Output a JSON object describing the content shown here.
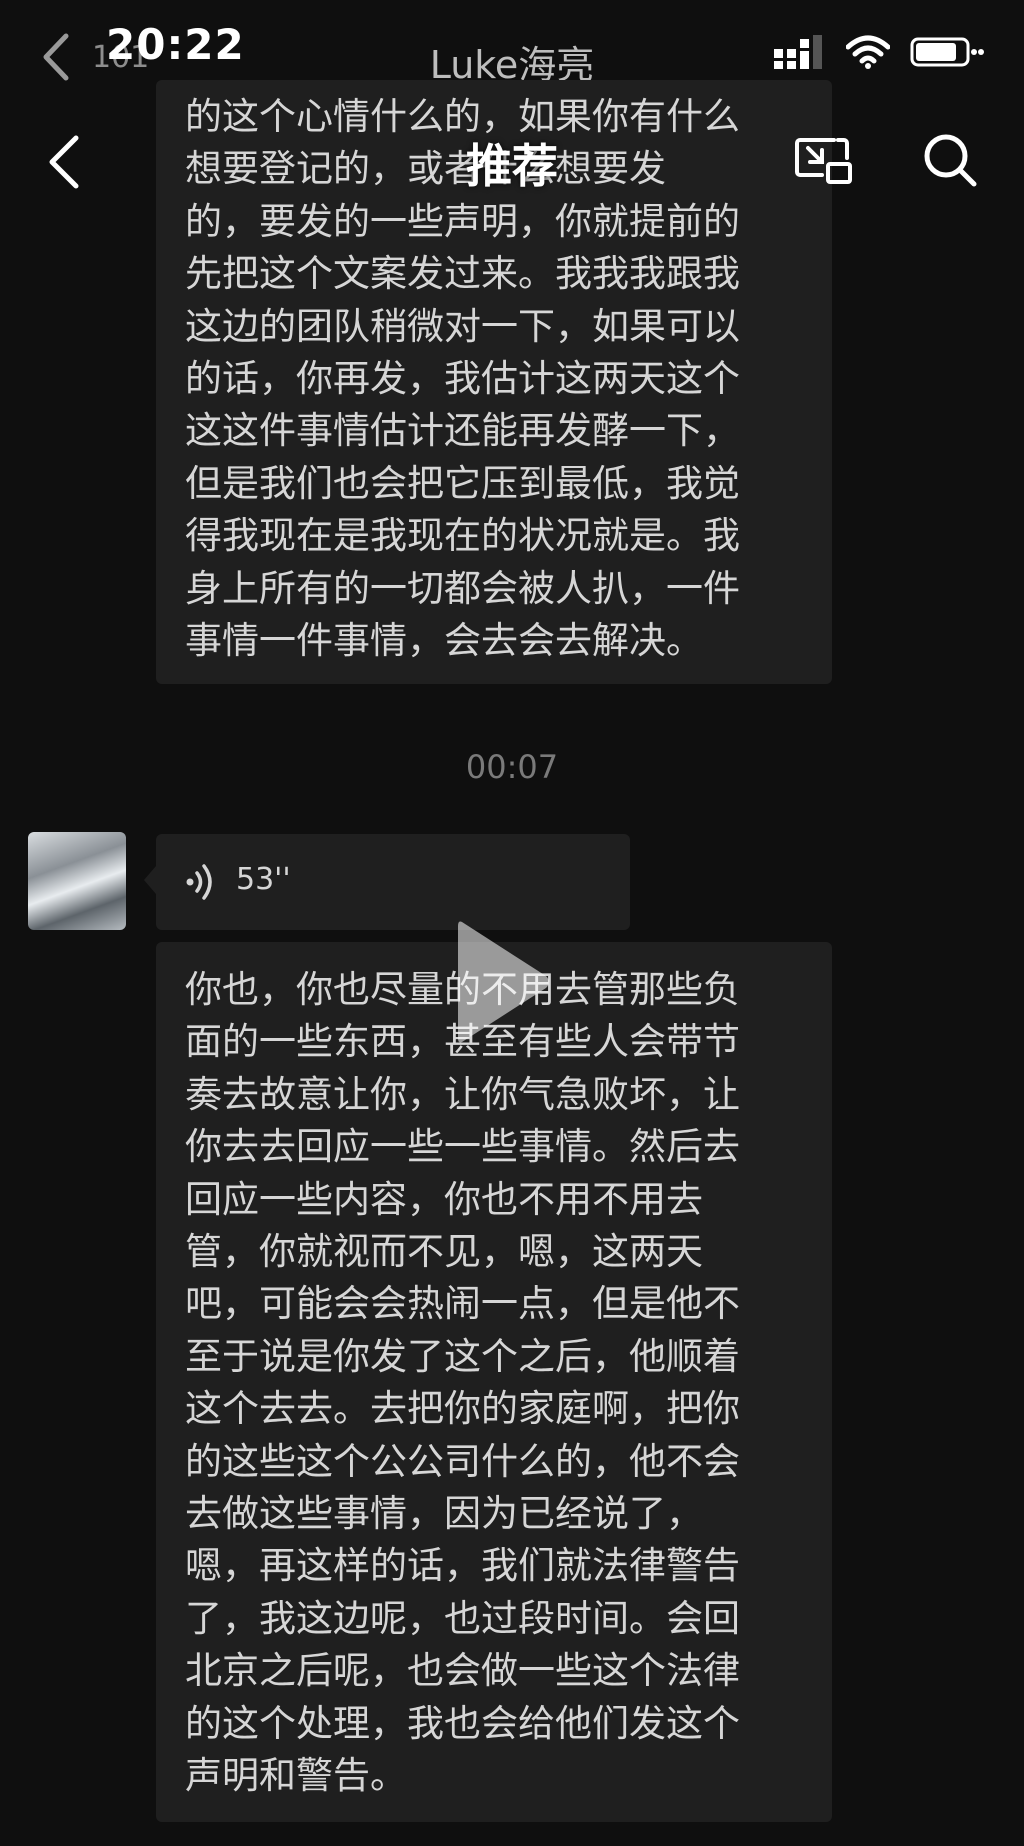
{
  "status_bar": {
    "time": "20:22"
  },
  "chat_header": {
    "unread_count": "101",
    "title": "Luke海亮"
  },
  "overlay": {
    "title": "推荐"
  },
  "messages": {
    "top_text": "的这个心情什么的，如果你有什么\n想要登记的，或者什么想要发\n的，要发的一些声明，你就提前的\n先把这个文案发过来。我我我跟我\n这边的团队稍微对一下，如果可以\n的话，你再发，我估计这两天这个\n这这件事情估计还能再发酵一下，\n但是我们也会把它压到最低，我觉\n得我现在是我现在的状况就是。我\n身上所有的一切都会被人扒，一件\n事情一件事情，会去会去解决。",
    "timestamp": "00:07",
    "voice_duration": "53''",
    "transcript_text": "你也，你也尽量的不用去管那些负\n面的一些东西，甚至有些人会带节\n奏去故意让你，让你气急败坏，让\n你去去回应一些一些事情。然后去\n回应一些内容，你也不用不用去\n管，你就视而不见，嗯，这两天\n吧，可能会会热闹一点，但是他不\n至于说是你发了这个之后，他顺着\n这个去去。去把你的家庭啊，把你\n的这些这个公公司什么的，他不会\n去做这些事情，因为已经说了，\n嗯，再这样的话，我们就法律警告\n了，我这边呢，也过段时间。会回\n北京之后呢，也会做一些这个法律\n的这个处理，我也会给他们发这个\n声明和警告。"
  },
  "icons": {
    "back": "chevron-left-icon",
    "signal": "signal-icon",
    "wifi": "wifi-icon",
    "battery": "battery-icon",
    "cast": "screen-cast-icon",
    "search": "search-icon",
    "voice": "voice-wave-icon",
    "play": "play-icon"
  },
  "colors": {
    "background": "#0f0f0f",
    "bubble": "#1f1f1f",
    "text": "#d6d6d6",
    "muted": "#7a7a7a"
  }
}
